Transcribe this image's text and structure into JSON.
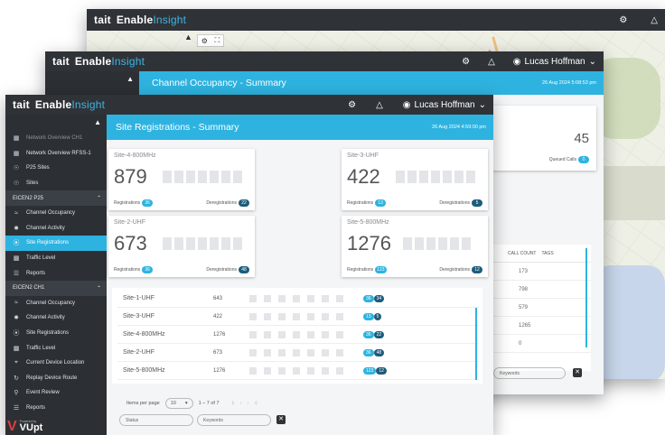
{
  "brand": {
    "tait": "tait",
    "enable": "Enable",
    "insight": "Insight"
  },
  "back_window": {
    "timestamp": "",
    "bar_icons": [
      "settings-icon",
      "bell-icon"
    ]
  },
  "mid_window": {
    "title": "Channel Occupancy - Summary",
    "timestamp": "26 Aug 2024 5:08:53 pm",
    "user": "Lucas Hoffman",
    "card_value": "45",
    "card_caption": "Queued Calls",
    "card_caption_badge": "0",
    "table_headers": {
      "call_count": "CALL COUNT",
      "tags": "TAGS"
    },
    "call_counts": [
      "173",
      "798",
      "579",
      "1265",
      "0"
    ],
    "keywords_placeholder": "Keywords"
  },
  "front_window": {
    "user": "Lucas Hoffman",
    "title": "Site Registrations - Summary",
    "timestamp": "26 Aug 2024 4:59:00 pm",
    "sidebar": {
      "items": [
        {
          "label": "Network Overview CH1",
          "icon": "grid-icon",
          "dim": true
        },
        {
          "label": "Network Overview RFSS-1",
          "icon": "grid-icon"
        },
        {
          "label": "P25 Sites",
          "icon": "antenna-icon"
        },
        {
          "label": "Sites",
          "icon": "antenna-icon"
        }
      ],
      "section1": "EICEN2 P25",
      "items2": [
        {
          "label": "Channel Occupancy",
          "icon": "wave-icon"
        },
        {
          "label": "Channel Activity",
          "icon": "activity-icon"
        },
        {
          "label": "Site Registrations",
          "icon": "compass-icon",
          "active": true
        },
        {
          "label": "Traffic Level",
          "icon": "chart-icon"
        },
        {
          "label": "Reports",
          "icon": "list-icon"
        }
      ],
      "section2": "EICEN2 CH1",
      "items3": [
        {
          "label": "Channel Occupancy",
          "icon": "wave-icon"
        },
        {
          "label": "Channel Activity",
          "icon": "activity-icon"
        },
        {
          "label": "Site Registrations",
          "icon": "compass-icon"
        },
        {
          "label": "Traffic Level",
          "icon": "chart-icon"
        },
        {
          "label": "Current Device Location",
          "icon": "location-icon"
        },
        {
          "label": "Replay Device Route",
          "icon": "replay-icon"
        },
        {
          "label": "Event Review",
          "icon": "search-icon"
        },
        {
          "label": "Reports",
          "icon": "list-icon"
        }
      ],
      "powered_by": "Powered by",
      "vupt": "VUpt"
    },
    "cards": [
      {
        "name": "Site-4-800MHz",
        "value": "879",
        "reg_label": "Registrations",
        "reg": "36",
        "dereg_label": "Deregistrations",
        "dereg": "22"
      },
      {
        "name": "Site-3-UHF",
        "value": "422",
        "reg_label": "Registrations",
        "reg": "13",
        "dereg_label": "Deregistrations",
        "dereg": "5"
      },
      {
        "name": "Site-2-UHF",
        "value": "673",
        "reg_label": "Registrations",
        "reg": "36",
        "dereg_label": "Deregistrations",
        "dereg": "48"
      },
      {
        "name": "Site-5-800MHz",
        "value": "1276",
        "reg_label": "Registrations",
        "reg": "123",
        "dereg_label": "Deregistrations",
        "dereg": "12"
      }
    ],
    "rows": [
      {
        "name": "Site-1-UHF",
        "count": "643",
        "reg": "36",
        "dereg": "34"
      },
      {
        "name": "Site-3-UHF",
        "count": "422",
        "reg": "13",
        "dereg": "5"
      },
      {
        "name": "Site-4-800MHz",
        "count": "1276",
        "reg": "36",
        "dereg": "22"
      },
      {
        "name": "Site-2-UHF",
        "count": "673",
        "reg": "36",
        "dereg": "48"
      },
      {
        "name": "Site-5-800MHz",
        "count": "1276",
        "reg": "123",
        "dereg": "12"
      }
    ],
    "pagination": {
      "items_per_page_label": "Items per page",
      "items_per_page": "10",
      "range": "1 – 7 of 7"
    },
    "status_placeholder": "Status",
    "keywords_placeholder": "Keywords"
  },
  "colors": {
    "accent": "#2eb3e0",
    "topbar": "#2f3338",
    "sidebar": "#2c3035",
    "badge_dark": "#1d5c7b"
  }
}
